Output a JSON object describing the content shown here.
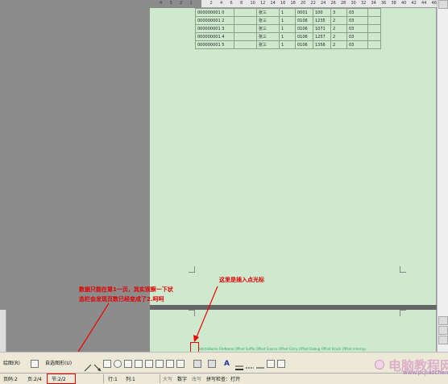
{
  "ruler": {
    "ticks": [
      "4",
      "3",
      "2",
      "1",
      "",
      "2",
      "4",
      "6",
      "8",
      "10",
      "12",
      "14",
      "16",
      "18",
      "20",
      "22",
      "24",
      "26",
      "28",
      "30",
      "32",
      "34",
      "36",
      "38",
      "40",
      "42",
      "44",
      "46"
    ]
  },
  "table": {
    "rows": [
      [
        "000000001 0",
        "",
        "张三",
        "1",
        "0001",
        "100",
        "3",
        "03",
        ""
      ],
      [
        "000000001 2",
        "",
        "张三",
        "1",
        "0106",
        "1235",
        "2",
        "03",
        ""
      ],
      [
        "000000001 3",
        "",
        "张三",
        "1",
        "0106",
        "1071",
        "2",
        "03",
        ""
      ],
      [
        "000000001 4",
        "",
        "张三",
        "1",
        "0106",
        "1257",
        "2",
        "03",
        ""
      ],
      [
        "000000001 5",
        "",
        "张三",
        "1",
        "0106",
        "1356",
        "2",
        "03",
        ""
      ]
    ]
  },
  "page2": {
    "field_text": "SetctaName  FileName  Offset  Suffix  Offset  Source  Offset  Entry  Offset  Debug  Offset  Brack  Offset  Interrup"
  },
  "annotations": {
    "left_line1": "数据只能在第1一页，其实观察一下状",
    "left_line2": "态栏会发现页数已经变成了2.呵呵",
    "right": "这里是插入点光标"
  },
  "toolbar": {
    "draw_menu": "绘图(R)",
    "autoshapes_menu": "自选图形(U)"
  },
  "statusbar": {
    "section": "页码:2",
    "page": "页:2/4",
    "section2": "节:2/2",
    "row": "行:1",
    "col": "列:1",
    "mode1": "大写",
    "mode2": "数字",
    "mode3": "改写",
    "mode4": "拼写检查：打开"
  },
  "watermark": {
    "text": "电脑教程网",
    "url": "www.pcjiaocheng.com"
  },
  "colors": {
    "page_bg": "#cfe9cf",
    "annotation": "#e00000",
    "desktop_grey": "#8c8c8c"
  }
}
